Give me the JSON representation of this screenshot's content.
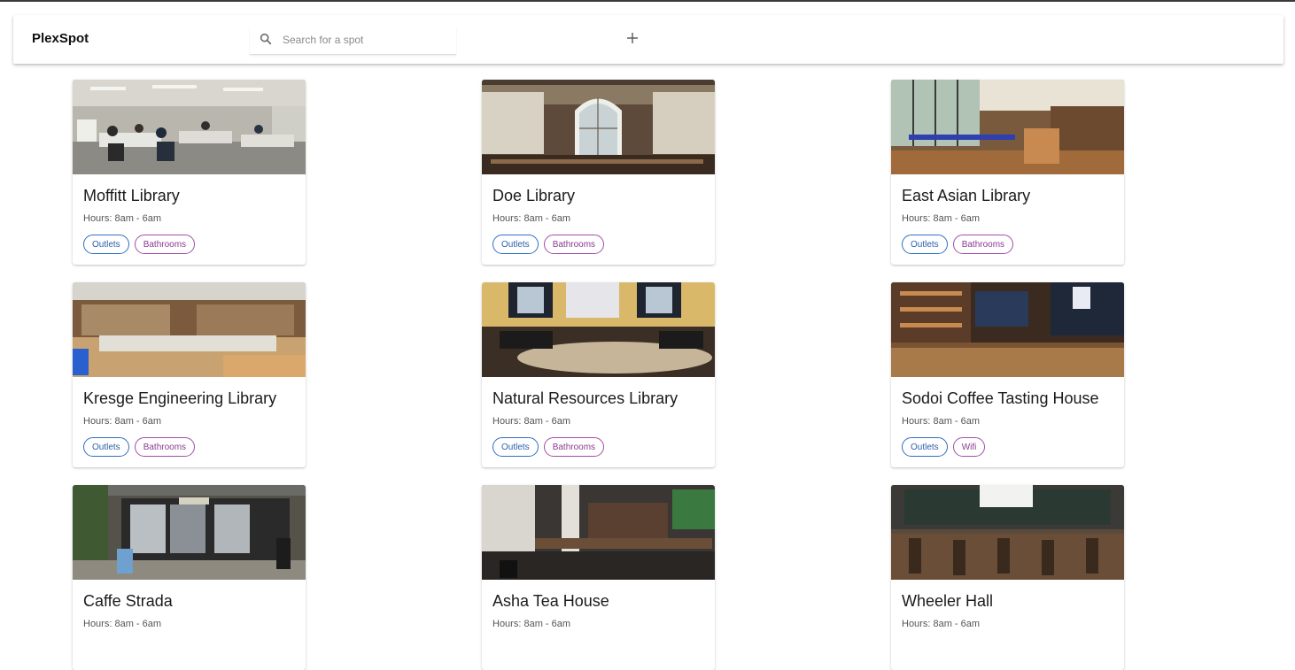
{
  "app": {
    "title": "PlexSpot",
    "search_placeholder": "Search for a spot"
  },
  "spots": [
    {
      "name": "Moffitt Library",
      "hours": "Hours: 8am - 6am",
      "tags": [
        {
          "label": "Outlets",
          "color": "blue"
        },
        {
          "label": "Bathrooms",
          "color": "purple"
        }
      ]
    },
    {
      "name": "Doe Library",
      "hours": "Hours: 8am - 6am",
      "tags": [
        {
          "label": "Outlets",
          "color": "blue"
        },
        {
          "label": "Bathrooms",
          "color": "purple"
        }
      ]
    },
    {
      "name": "East Asian Library",
      "hours": "Hours: 8am - 6am",
      "tags": [
        {
          "label": "Outlets",
          "color": "blue"
        },
        {
          "label": "Bathrooms",
          "color": "purple"
        }
      ]
    },
    {
      "name": "Kresge Engineering Library",
      "hours": "Hours: 8am - 6am",
      "tags": [
        {
          "label": "Outlets",
          "color": "blue"
        },
        {
          "label": "Bathrooms",
          "color": "purple"
        }
      ]
    },
    {
      "name": "Natural Resources Library",
      "hours": "Hours: 8am - 6am",
      "tags": [
        {
          "label": "Outlets",
          "color": "blue"
        },
        {
          "label": "Bathrooms",
          "color": "purple"
        }
      ]
    },
    {
      "name": "Sodoi Coffee Tasting House",
      "hours": "Hours: 8am - 6am",
      "tags": [
        {
          "label": "Outlets",
          "color": "blue"
        },
        {
          "label": "Wifi",
          "color": "purple"
        }
      ]
    },
    {
      "name": "Caffe Strada",
      "hours": "Hours: 8am - 6am",
      "tags": []
    },
    {
      "name": "Asha Tea House",
      "hours": "Hours: 8am - 6am",
      "tags": []
    },
    {
      "name": "Wheeler Hall",
      "hours": "Hours: 8am - 6am",
      "tags": []
    }
  ],
  "colors": {
    "chip_blue": "#2f6fc5",
    "chip_purple": "#a24ea8"
  }
}
